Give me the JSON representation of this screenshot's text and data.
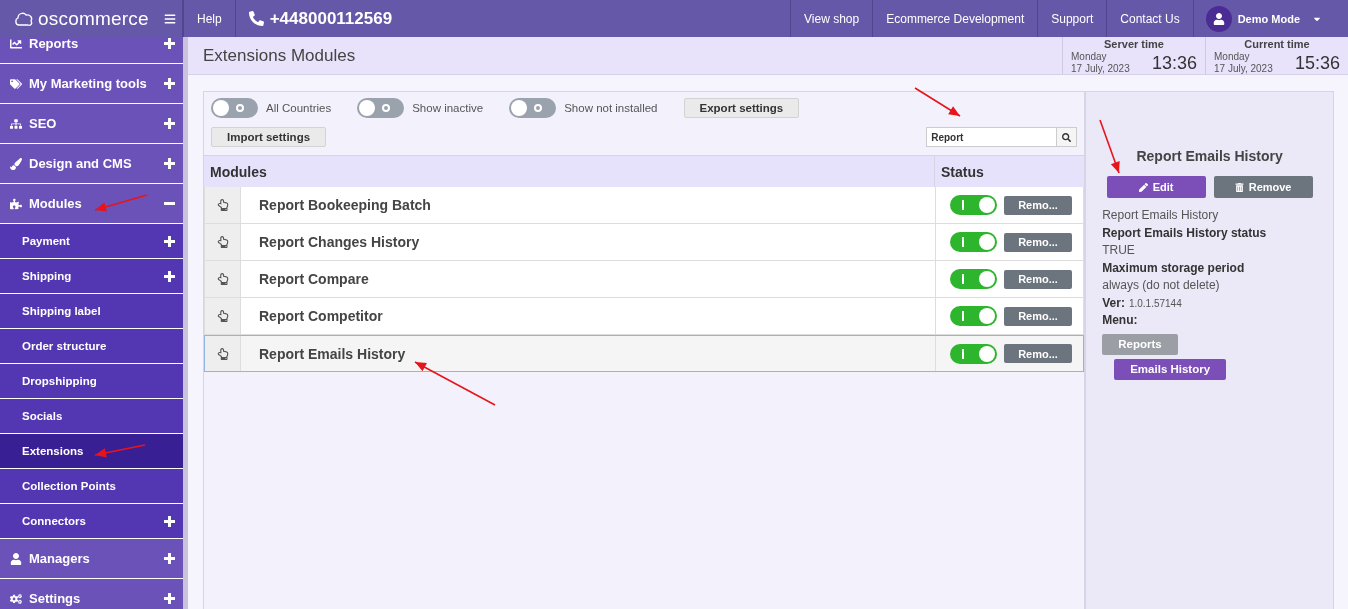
{
  "topbar": {
    "logo": "oscommerce",
    "help": "Help",
    "phone": "+448000112569",
    "links": [
      "View shop",
      "Ecommerce Development",
      "Support",
      "Contact Us"
    ],
    "user": "Demo Mode"
  },
  "sidebar": {
    "items": [
      {
        "label": "Reports",
        "kind": "folder",
        "expanded": false
      },
      {
        "label": "My Marketing tools",
        "kind": "folder",
        "expanded": false
      },
      {
        "label": "SEO",
        "kind": "folder",
        "expanded": false
      },
      {
        "label": "Design and CMS",
        "kind": "folder",
        "expanded": false
      },
      {
        "label": "Modules",
        "kind": "folder",
        "expanded": true,
        "children": [
          {
            "label": "Payment",
            "kind": "folder",
            "expanded": false,
            "selected": false
          },
          {
            "label": "Shipping",
            "kind": "folder",
            "expanded": false,
            "selected": false
          },
          {
            "label": "Shipping label",
            "kind": "page",
            "selected": false
          },
          {
            "label": "Order structure",
            "kind": "page",
            "selected": false
          },
          {
            "label": "Dropshipping",
            "kind": "page",
            "selected": false
          },
          {
            "label": "Socials",
            "kind": "page",
            "selected": false
          },
          {
            "label": "Extensions",
            "kind": "page",
            "selected": true
          },
          {
            "label": "Collection Points",
            "kind": "page",
            "selected": false
          },
          {
            "label": "Connectors",
            "kind": "folder",
            "expanded": false,
            "selected": false
          }
        ]
      },
      {
        "label": "Managers",
        "kind": "folder",
        "expanded": false
      },
      {
        "label": "Settings",
        "kind": "folder",
        "expanded": false
      }
    ]
  },
  "header": {
    "title": "Extensions Modules",
    "clocks": [
      {
        "label": "Server time",
        "day": "Monday",
        "date": "17 July, 2023",
        "time": "13:36"
      },
      {
        "label": "Current time",
        "day": "Monday",
        "date": "17 July, 2023",
        "time": "15:36"
      }
    ]
  },
  "filters": [
    {
      "label": "All Countries",
      "on": false
    },
    {
      "label": "Show inactive",
      "on": false
    },
    {
      "label": "Show not installed",
      "on": false
    }
  ],
  "buttons": [
    "Export settings",
    "Import settings"
  ],
  "search": {
    "value": "Report"
  },
  "table": {
    "columns": [
      "Modules",
      "Status"
    ],
    "rows": [
      {
        "name": "Report Bookeeping Batch",
        "enabled": true,
        "action": "Remo...",
        "selected": false
      },
      {
        "name": "Report Changes History",
        "enabled": true,
        "action": "Remo...",
        "selected": false
      },
      {
        "name": "Report Compare",
        "enabled": true,
        "action": "Remo...",
        "selected": false
      },
      {
        "name": "Report Competitor",
        "enabled": true,
        "action": "Remo...",
        "selected": false
      },
      {
        "name": "Report Emails History",
        "enabled": true,
        "action": "Remo...",
        "selected": true
      }
    ]
  },
  "details": {
    "title": "Report Emails History",
    "edit": "Edit",
    "remove": "Remove",
    "lines": [
      {
        "kind": "text",
        "text": "Report Emails History"
      },
      {
        "kind": "label",
        "text": "Report Emails History status"
      },
      {
        "kind": "text",
        "text": "TRUE"
      },
      {
        "kind": "label",
        "text": "Maximum storage period"
      },
      {
        "kind": "text",
        "text": "always (do not delete)"
      }
    ],
    "version_label": "Ver:",
    "version": "1.0.1.57144",
    "menu_label": "Menu:",
    "menu": [
      {
        "label": "Reports",
        "kind": "parent"
      },
      {
        "label": "Emails History",
        "kind": "child"
      }
    ]
  }
}
